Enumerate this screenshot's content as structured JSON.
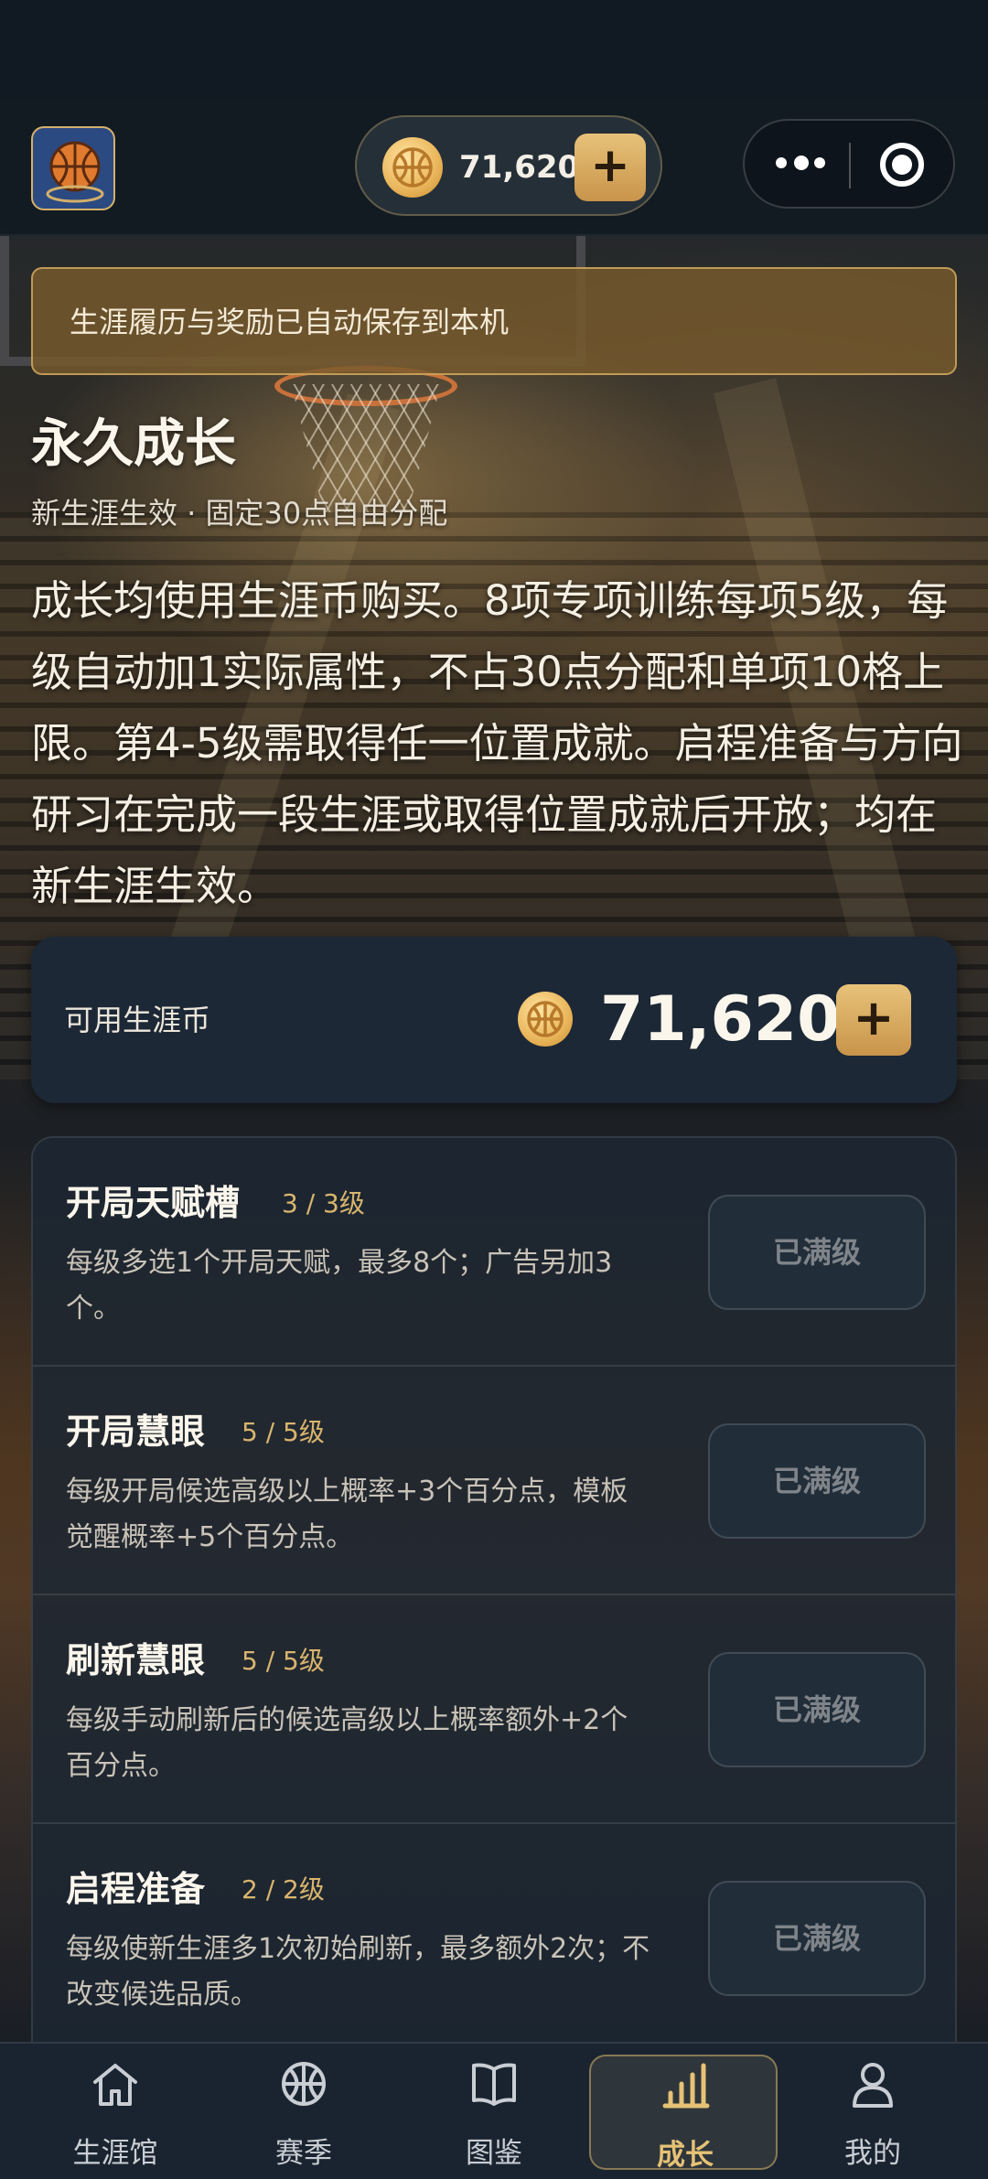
{
  "header": {
    "coin_balance": "71,620",
    "plus_label": "+"
  },
  "notice": "生涯履历与奖励已自动保存到本机",
  "page": {
    "title": "永久成长",
    "subtitle": "新生涯生效 · 固定30点自由分配",
    "description": "成长均使用生涯币购买。8项专项训练每项5级，每级自动加1实际属性，不占30点分配和单项10格上限。第4-5级需取得任一位置成就。启程准备与方向研习在完成一段生涯或取得位置成就后开放；均在新生涯生效。"
  },
  "balance_card": {
    "label": "可用生涯币",
    "amount": "71,620",
    "plus_label": "+"
  },
  "upgrades": [
    {
      "name": "开局天赋槽",
      "level": "3 / 3级",
      "desc": "每级多选1个开局天赋，最多8个；广告另加3个。",
      "button": "已满级"
    },
    {
      "name": "开局慧眼",
      "level": "5 / 5级",
      "desc": "每级开局候选高级以上概率+3个百分点，模板觉醒概率+5个百分点。",
      "button": "已满级"
    },
    {
      "name": "刷新慧眼",
      "level": "5 / 5级",
      "desc": "每级手动刷新后的候选高级以上概率额外+2个百分点。",
      "button": "已满级"
    },
    {
      "name": "启程准备",
      "level": "2 / 2级",
      "desc": "每级使新生涯多1次初始刷新，最多额外2次；不改变候选品质。",
      "button": "已满级"
    }
  ],
  "nav": [
    {
      "label": "生涯馆",
      "icon": "home-icon"
    },
    {
      "label": "赛季",
      "icon": "basketball-icon"
    },
    {
      "label": "图鉴",
      "icon": "book-icon"
    },
    {
      "label": "成长",
      "icon": "bar-chart-icon",
      "active": true
    },
    {
      "label": "我的",
      "icon": "user-icon"
    }
  ],
  "colors": {
    "accent_gold": "#d9b56e",
    "card_bg": "#1c2836",
    "nav_active": "#e6c276"
  }
}
